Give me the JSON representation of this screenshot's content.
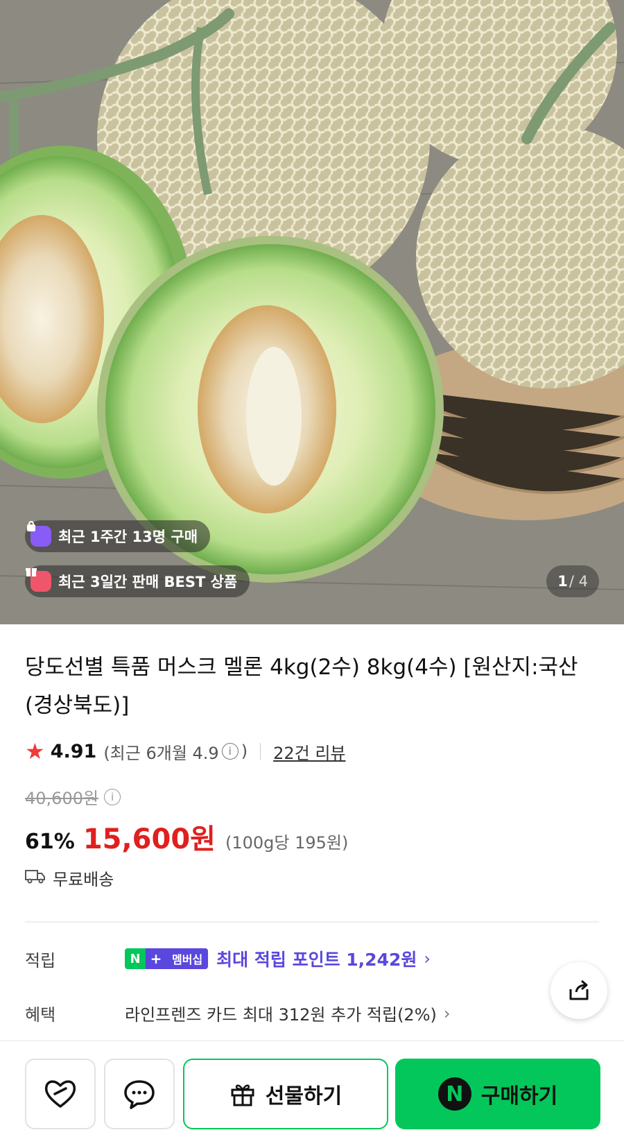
{
  "hero": {
    "image_desc": "melon",
    "badges": [
      {
        "label": "최근 1주간 13명 구매",
        "icon": "shopping-bag-icon",
        "color": "#8a5cf6"
      },
      {
        "label": "최근 3일간 판매 BEST 상품",
        "icon": "gift-box-icon",
        "color": "#f0566b"
      }
    ],
    "counter": {
      "current": "1",
      "total": "/ 4"
    }
  },
  "product": {
    "title": "당도선별 특품 머스크 멜론 4kg(2수) 8kg(4수) [원산지:국산(경상북도)]",
    "rating": {
      "score": "4.91",
      "recent_prefix": "(최근 6개월 4.9",
      "recent_suffix": ")",
      "reviews": "22건 리뷰"
    },
    "original_price": "40,600원",
    "discount": "61%",
    "price": "15,600원",
    "unit_price": "(100g당 195원)",
    "shipping": "무료배송"
  },
  "benefits": {
    "points_label": "적립",
    "membership": {
      "n": "N",
      "plus": "+",
      "text": "멤버십"
    },
    "points_text": "최대 적립 포인트 1,242원",
    "benefit_label": "혜택",
    "benefit_text": "라인프렌즈 카드 최대 312원 추가 적립(2%)"
  },
  "bottom": {
    "gift_label": "선물하기",
    "buy_label": "구매하기",
    "n_logo": "N"
  },
  "colors": {
    "accent_green": "#03c75a",
    "price_red": "#e0201e",
    "npay_purple": "#5a47dd"
  }
}
